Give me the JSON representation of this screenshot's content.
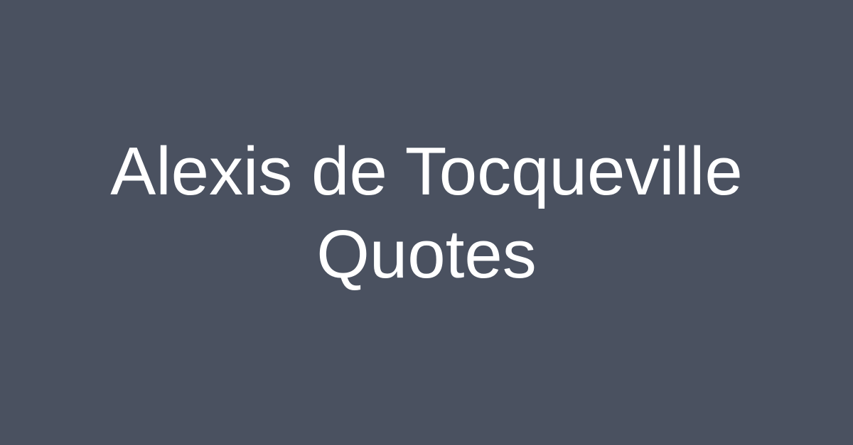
{
  "card": {
    "background_color": "#4a5160",
    "text_color": "#ffffff",
    "title_lines": [
      "Alexis de Tocqueville",
      "Quotes"
    ]
  }
}
